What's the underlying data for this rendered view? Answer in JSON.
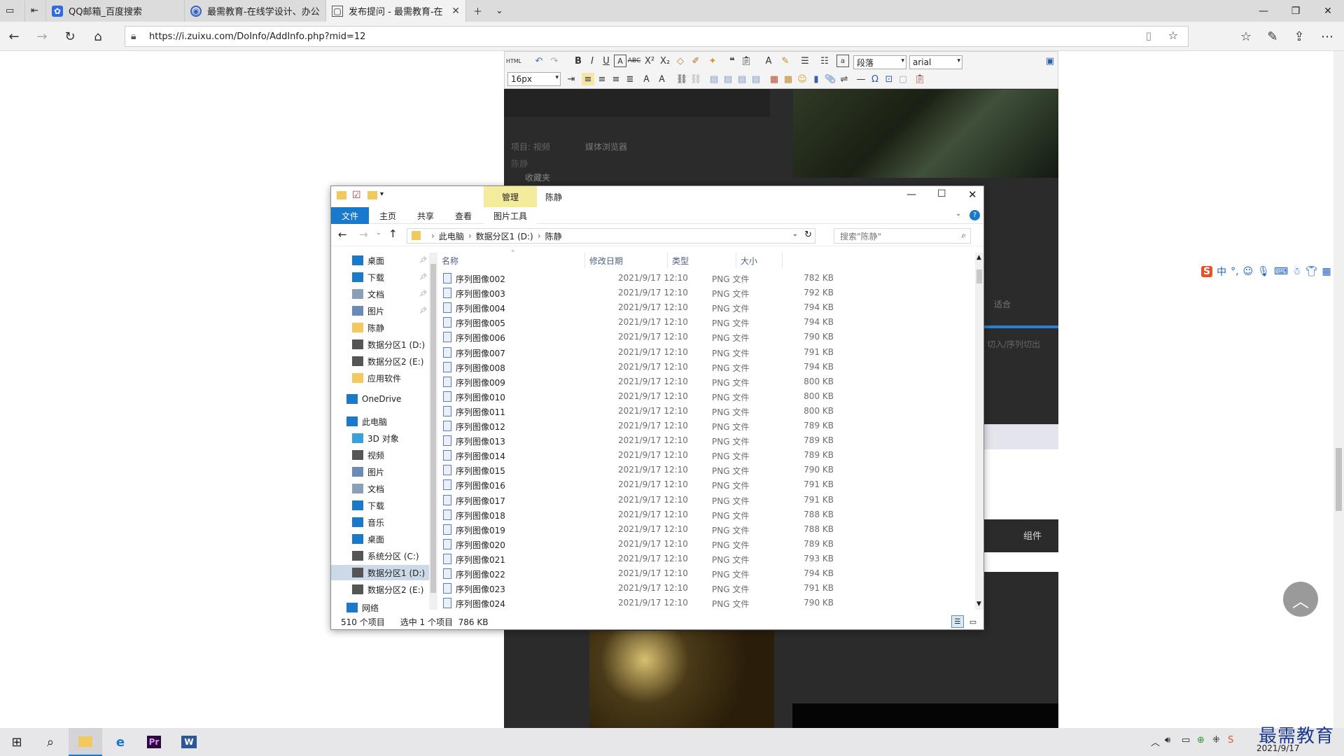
{
  "browser": {
    "tabs": [
      {
        "label": "QQ邮箱_百度搜索",
        "icon": "paw-icon"
      },
      {
        "label": "最需教育-在线学设计、办公",
        "icon": "globe-icon"
      },
      {
        "label": "发布提问 - 最需教育-在",
        "icon": "page-icon"
      }
    ],
    "url": "https://i.zuixu.com/DoInfo/AddInfo.php?mid=12"
  },
  "editor": {
    "paragraph_select": "段落",
    "font_select": "arial",
    "size_select": "16px",
    "bg_texts": [
      "项目: 视频",
      "媒体浏览器",
      "陈静",
      "收藏夹",
      "适合",
      "切入/序列切出",
      "组件"
    ]
  },
  "explorer": {
    "title": "陈静",
    "manage_tab": "管理",
    "picture_tools": "图片工具",
    "ribbon_tabs": [
      "文件",
      "主页",
      "共享",
      "查看"
    ],
    "breadcrumb": [
      "此电脑",
      "数据分区1 (D:)",
      "陈静"
    ],
    "search_placeholder": "搜索\"陈静\"",
    "sidebar": [
      {
        "label": "桌面",
        "pinned": true
      },
      {
        "label": "下载",
        "pinned": true
      },
      {
        "label": "文档",
        "pinned": true
      },
      {
        "label": "图片",
        "pinned": true
      },
      {
        "label": "陈静",
        "pinned": false
      },
      {
        "label": "数据分区1 (D:)",
        "pinned": false
      },
      {
        "label": "数据分区2 (E:)",
        "pinned": false
      },
      {
        "label": "应用软件",
        "pinned": false
      },
      {
        "label": "OneDrive",
        "pinned": false
      },
      {
        "label": "此电脑",
        "pinned": false
      },
      {
        "label": "3D 对象",
        "pinned": false
      },
      {
        "label": "视频",
        "pinned": false
      },
      {
        "label": "图片",
        "pinned": false
      },
      {
        "label": "文档",
        "pinned": false
      },
      {
        "label": "下载",
        "pinned": false
      },
      {
        "label": "音乐",
        "pinned": false
      },
      {
        "label": "桌面",
        "pinned": false
      },
      {
        "label": "系统分区 (C:)",
        "pinned": false
      },
      {
        "label": "数据分区1 (D:)",
        "pinned": false
      },
      {
        "label": "数据分区2 (E:)",
        "pinned": false
      },
      {
        "label": "网络",
        "pinned": false
      }
    ],
    "columns": [
      "名称",
      "修改日期",
      "类型",
      "大小"
    ],
    "files": [
      {
        "name": "序列图像002",
        "date": "2021/9/17 12:10",
        "type": "PNG 文件",
        "size": "782 KB"
      },
      {
        "name": "序列图像003",
        "date": "2021/9/17 12:10",
        "type": "PNG 文件",
        "size": "792 KB"
      },
      {
        "name": "序列图像004",
        "date": "2021/9/17 12:10",
        "type": "PNG 文件",
        "size": "794 KB"
      },
      {
        "name": "序列图像005",
        "date": "2021/9/17 12:10",
        "type": "PNG 文件",
        "size": "794 KB"
      },
      {
        "name": "序列图像006",
        "date": "2021/9/17 12:10",
        "type": "PNG 文件",
        "size": "790 KB"
      },
      {
        "name": "序列图像007",
        "date": "2021/9/17 12:10",
        "type": "PNG 文件",
        "size": "791 KB"
      },
      {
        "name": "序列图像008",
        "date": "2021/9/17 12:10",
        "type": "PNG 文件",
        "size": "794 KB"
      },
      {
        "name": "序列图像009",
        "date": "2021/9/17 12:10",
        "type": "PNG 文件",
        "size": "800 KB"
      },
      {
        "name": "序列图像010",
        "date": "2021/9/17 12:10",
        "type": "PNG 文件",
        "size": "800 KB"
      },
      {
        "name": "序列图像011",
        "date": "2021/9/17 12:10",
        "type": "PNG 文件",
        "size": "800 KB"
      },
      {
        "name": "序列图像012",
        "date": "2021/9/17 12:10",
        "type": "PNG 文件",
        "size": "789 KB"
      },
      {
        "name": "序列图像013",
        "date": "2021/9/17 12:10",
        "type": "PNG 文件",
        "size": "789 KB"
      },
      {
        "name": "序列图像014",
        "date": "2021/9/17 12:10",
        "type": "PNG 文件",
        "size": "789 KB"
      },
      {
        "name": "序列图像015",
        "date": "2021/9/17 12:10",
        "type": "PNG 文件",
        "size": "790 KB"
      },
      {
        "name": "序列图像016",
        "date": "2021/9/17 12:10",
        "type": "PNG 文件",
        "size": "791 KB"
      },
      {
        "name": "序列图像017",
        "date": "2021/9/17 12:10",
        "type": "PNG 文件",
        "size": "791 KB"
      },
      {
        "name": "序列图像018",
        "date": "2021/9/17 12:10",
        "type": "PNG 文件",
        "size": "788 KB"
      },
      {
        "name": "序列图像019",
        "date": "2021/9/17 12:10",
        "type": "PNG 文件",
        "size": "788 KB"
      },
      {
        "name": "序列图像020",
        "date": "2021/9/17 12:10",
        "type": "PNG 文件",
        "size": "789 KB"
      },
      {
        "name": "序列图像021",
        "date": "2021/9/17 12:10",
        "type": "PNG 文件",
        "size": "793 KB"
      },
      {
        "name": "序列图像022",
        "date": "2021/9/17 12:10",
        "type": "PNG 文件",
        "size": "794 KB"
      },
      {
        "name": "序列图像023",
        "date": "2021/9/17 12:10",
        "type": "PNG 文件",
        "size": "791 KB"
      },
      {
        "name": "序列图像024",
        "date": "2021/9/17 12:10",
        "type": "PNG 文件",
        "size": "790 KB"
      }
    ],
    "status_count": "510 个项目",
    "status_selected": "选中 1 个项目  786 KB"
  },
  "ime": {
    "lang": "中"
  },
  "taskbar": {
    "date": "2021/9/17"
  },
  "watermark": "最需教育",
  "colors": {
    "accent": "#1979ca",
    "manage_tab": "#f5eb9d",
    "sidebar_selected": "#ccd9e8"
  }
}
